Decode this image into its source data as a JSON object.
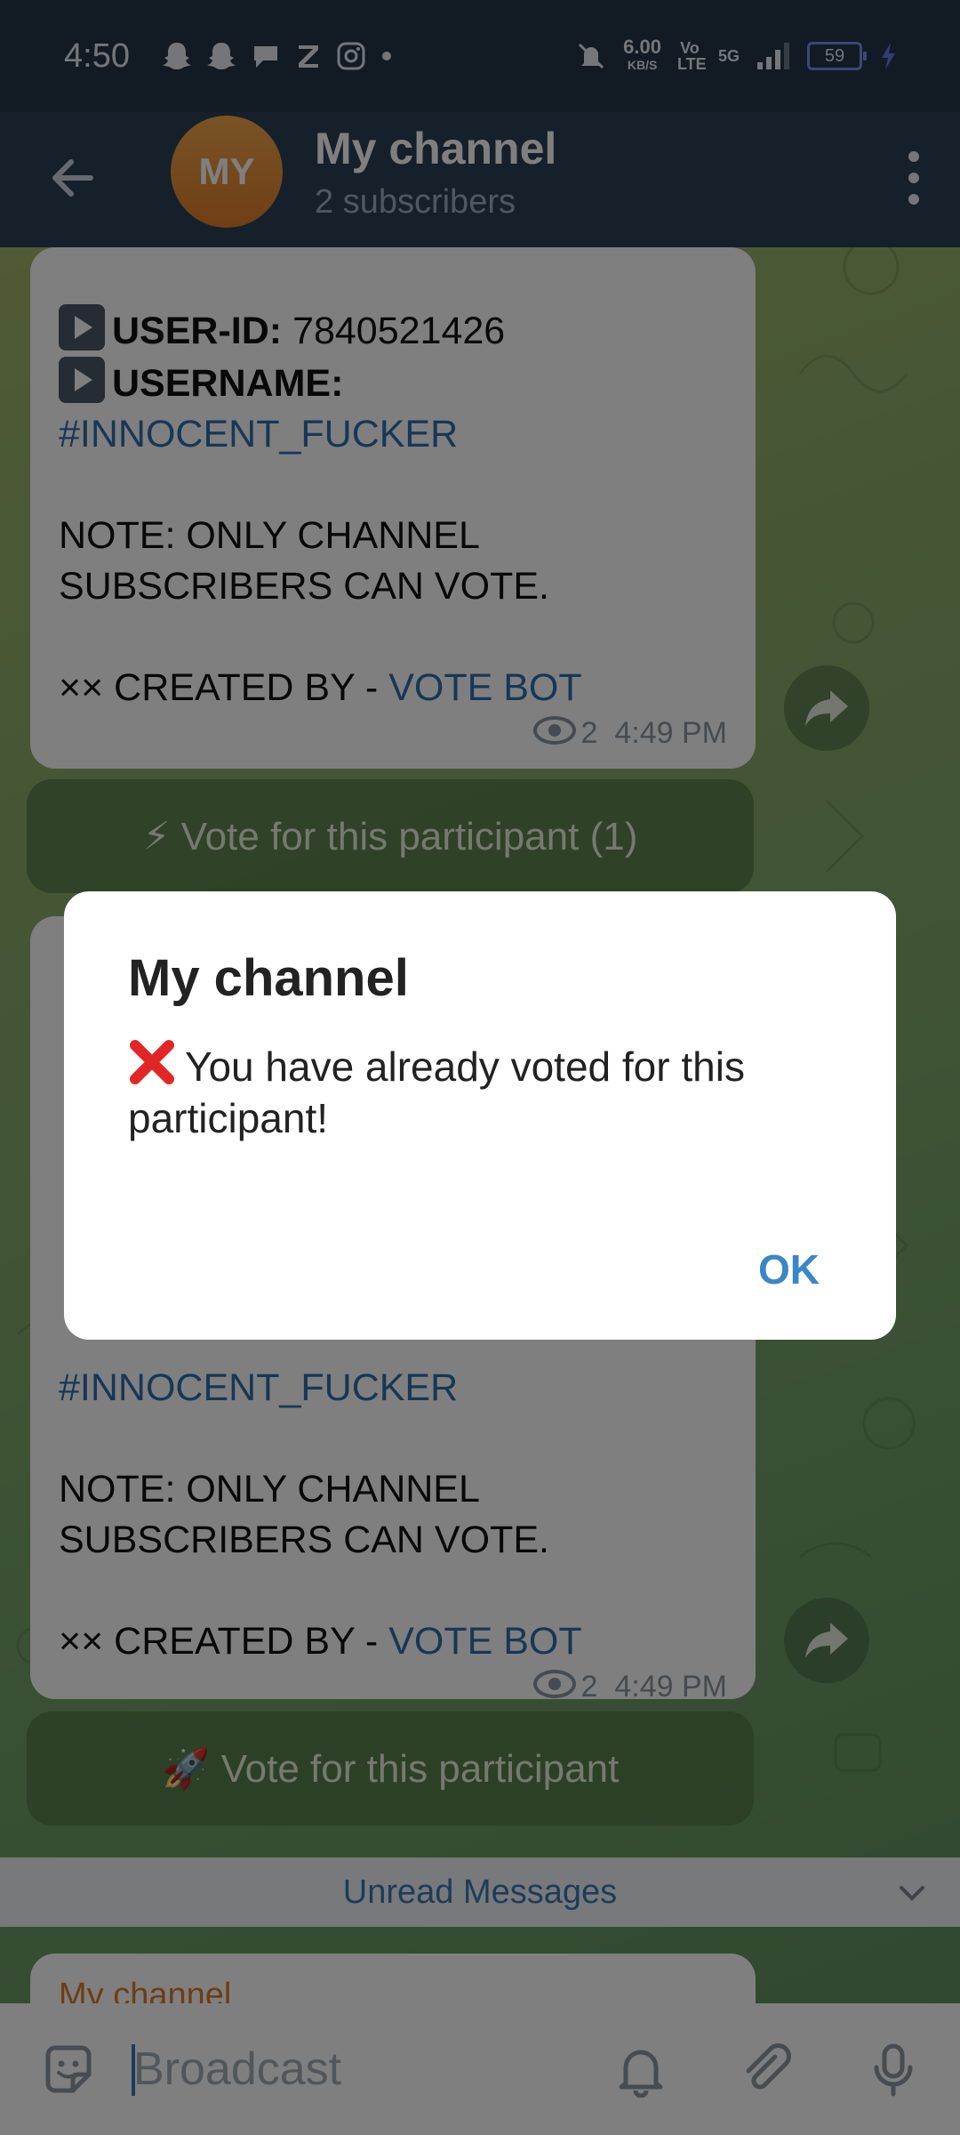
{
  "status_bar": {
    "time": "4:50",
    "net_speed_value": "6.00",
    "net_speed_unit": "KB/S",
    "volte": "Vo LTE",
    "network": "5G",
    "battery": "59"
  },
  "header": {
    "avatar_initials": "MY",
    "title": "My channel",
    "subtitle": "2 subscribers"
  },
  "messages": [
    {
      "user_id_label": "USER-ID:",
      "user_id_value": "7840521426",
      "username_label": "USERNAME:",
      "username_value": "#INNOCENT_FUCKER",
      "note_line1": "NOTE: ONLY CHANNEL",
      "note_line2": "SUBSCRIBERS CAN VOTE.",
      "created_prefix": "×× CREATED BY - ",
      "created_link": "VOTE BOT",
      "views": "2",
      "time": "4:49 PM",
      "vote_button": "⚡ Vote for this participant (1)"
    },
    {
      "username_value": "#INNOCENT_FUCKER",
      "note_line1": "NOTE: ONLY CHANNEL",
      "note_line2": "SUBSCRIBERS CAN VOTE.",
      "created_prefix": "×× CREATED BY - ",
      "created_link": "VOTE BOT",
      "views": "2",
      "time": "4:49 PM",
      "vote_button": "🚀 Vote for this participant"
    }
  ],
  "unread_banner": "Unread Messages",
  "next_message_sender": "My channel",
  "input": {
    "placeholder": "Broadcast"
  },
  "dialog": {
    "title": "My channel",
    "message": "You have already voted for this participant!",
    "ok_label": "OK"
  }
}
